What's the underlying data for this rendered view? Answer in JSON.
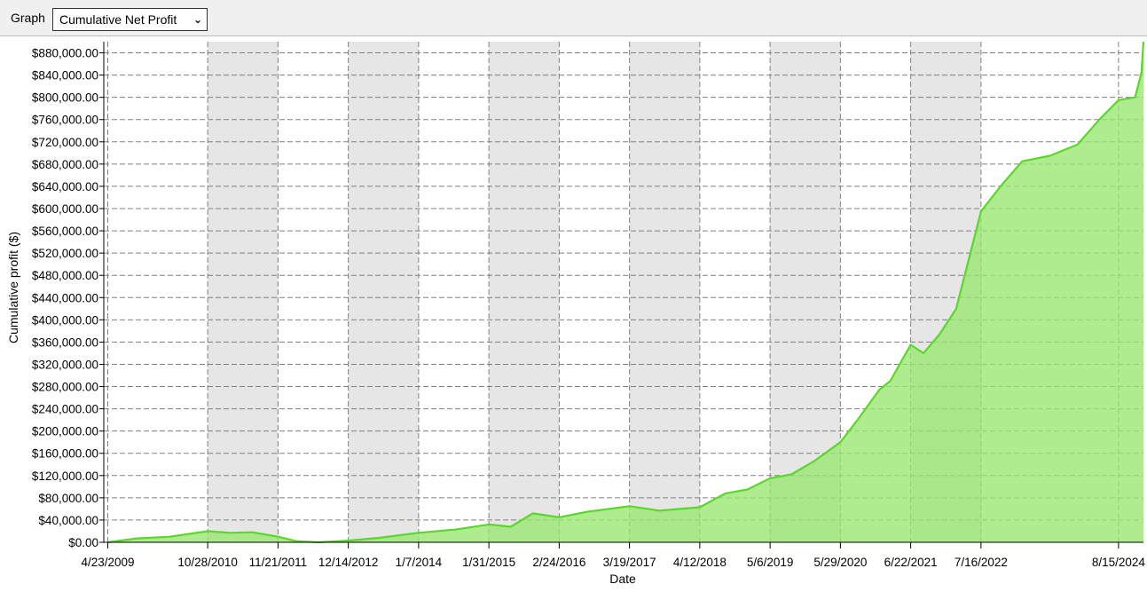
{
  "toolbar": {
    "graph_label": "Graph",
    "graph_select_value": "Cumulative Net Profit"
  },
  "colors": {
    "line": "#5cd62e",
    "fill": "#99e66f",
    "band": "#e6e6e6",
    "grid": "#808080"
  },
  "chart_data": {
    "type": "area",
    "title": "",
    "xlabel": "Date",
    "ylabel": "Cumulative profit ($)",
    "ylim": [
      0,
      900000
    ],
    "xlim": [
      "2009-04-01",
      "2024-12-31"
    ],
    "y_ticks": [
      0,
      40000,
      80000,
      120000,
      160000,
      200000,
      240000,
      280000,
      320000,
      360000,
      400000,
      440000,
      480000,
      520000,
      560000,
      600000,
      640000,
      680000,
      720000,
      760000,
      800000,
      840000,
      880000
    ],
    "y_tick_labels": [
      "$0.00",
      "$40,000.00",
      "$80,000.00",
      "$120,000.00",
      "$160,000.00",
      "$200,000.00",
      "$240,000.00",
      "$280,000.00",
      "$320,000.00",
      "$360,000.00",
      "$400,000.00",
      "$440,000.00",
      "$480,000.00",
      "$520,000.00",
      "$560,000.00",
      "$600,000.00",
      "$640,000.00",
      "$680,000.00",
      "$720,000.00",
      "$760,000.00",
      "$800,000.00",
      "$840,000.00",
      "$880,000.00"
    ],
    "x_tick_dates": [
      "2009-04-23",
      "2010-10-28",
      "2011-11-21",
      "2012-12-14",
      "2014-01-07",
      "2015-01-31",
      "2016-02-24",
      "2017-03-19",
      "2018-04-12",
      "2019-05-06",
      "2020-05-29",
      "2021-06-22",
      "2022-07-16",
      "2024-08-15"
    ],
    "x_tick_labels": [
      "4/23/2009",
      "10/28/2010",
      "11/21/2011",
      "12/14/2012",
      "1/7/2014",
      "1/31/2015",
      "2/24/2016",
      "3/19/2017",
      "4/12/2018",
      "5/6/2019",
      "5/29/2020",
      "6/22/2021",
      "7/16/2022",
      "8/15/2024"
    ],
    "shaded_bands": [
      [
        "2010-10-28",
        "2011-11-21"
      ],
      [
        "2012-12-14",
        "2014-01-07"
      ],
      [
        "2015-01-31",
        "2016-02-24"
      ],
      [
        "2017-03-19",
        "2018-04-12"
      ],
      [
        "2019-05-06",
        "2020-05-29"
      ],
      [
        "2021-06-22",
        "2022-07-16"
      ]
    ],
    "grid": true,
    "series": [
      {
        "x": [
          "2009-04-23",
          "2009-10-01",
          "2010-04-01",
          "2010-10-28",
          "2011-03-01",
          "2011-07-01",
          "2011-11-21",
          "2012-03-01",
          "2012-07-01",
          "2012-12-14",
          "2013-06-01",
          "2014-01-07",
          "2014-08-01",
          "2015-01-31",
          "2015-06-01",
          "2015-10-01",
          "2016-02-24",
          "2016-08-01",
          "2017-03-19",
          "2017-09-01",
          "2018-04-12",
          "2018-09-01",
          "2019-01-01",
          "2019-05-06",
          "2019-09-01",
          "2020-01-01",
          "2020-05-29",
          "2020-09-01",
          "2021-01-01",
          "2021-03-01",
          "2021-06-22",
          "2021-09-01",
          "2021-12-01",
          "2022-03-01",
          "2022-07-16",
          "2022-11-01",
          "2023-03-01",
          "2023-08-01",
          "2024-01-01",
          "2024-05-01",
          "2024-08-15",
          "2024-11-15",
          "2024-12-20",
          "2024-12-31"
        ],
        "y": [
          0,
          7000,
          10000,
          20000,
          17000,
          18000,
          10000,
          2000,
          0,
          3000,
          8000,
          17000,
          23000,
          32000,
          28000,
          52000,
          45000,
          55000,
          65000,
          57000,
          63000,
          88000,
          95000,
          115000,
          122000,
          145000,
          180000,
          220000,
          275000,
          290000,
          355000,
          340000,
          375000,
          420000,
          595000,
          640000,
          685000,
          695000,
          715000,
          760000,
          795000,
          800000,
          845000,
          900000
        ]
      }
    ]
  }
}
